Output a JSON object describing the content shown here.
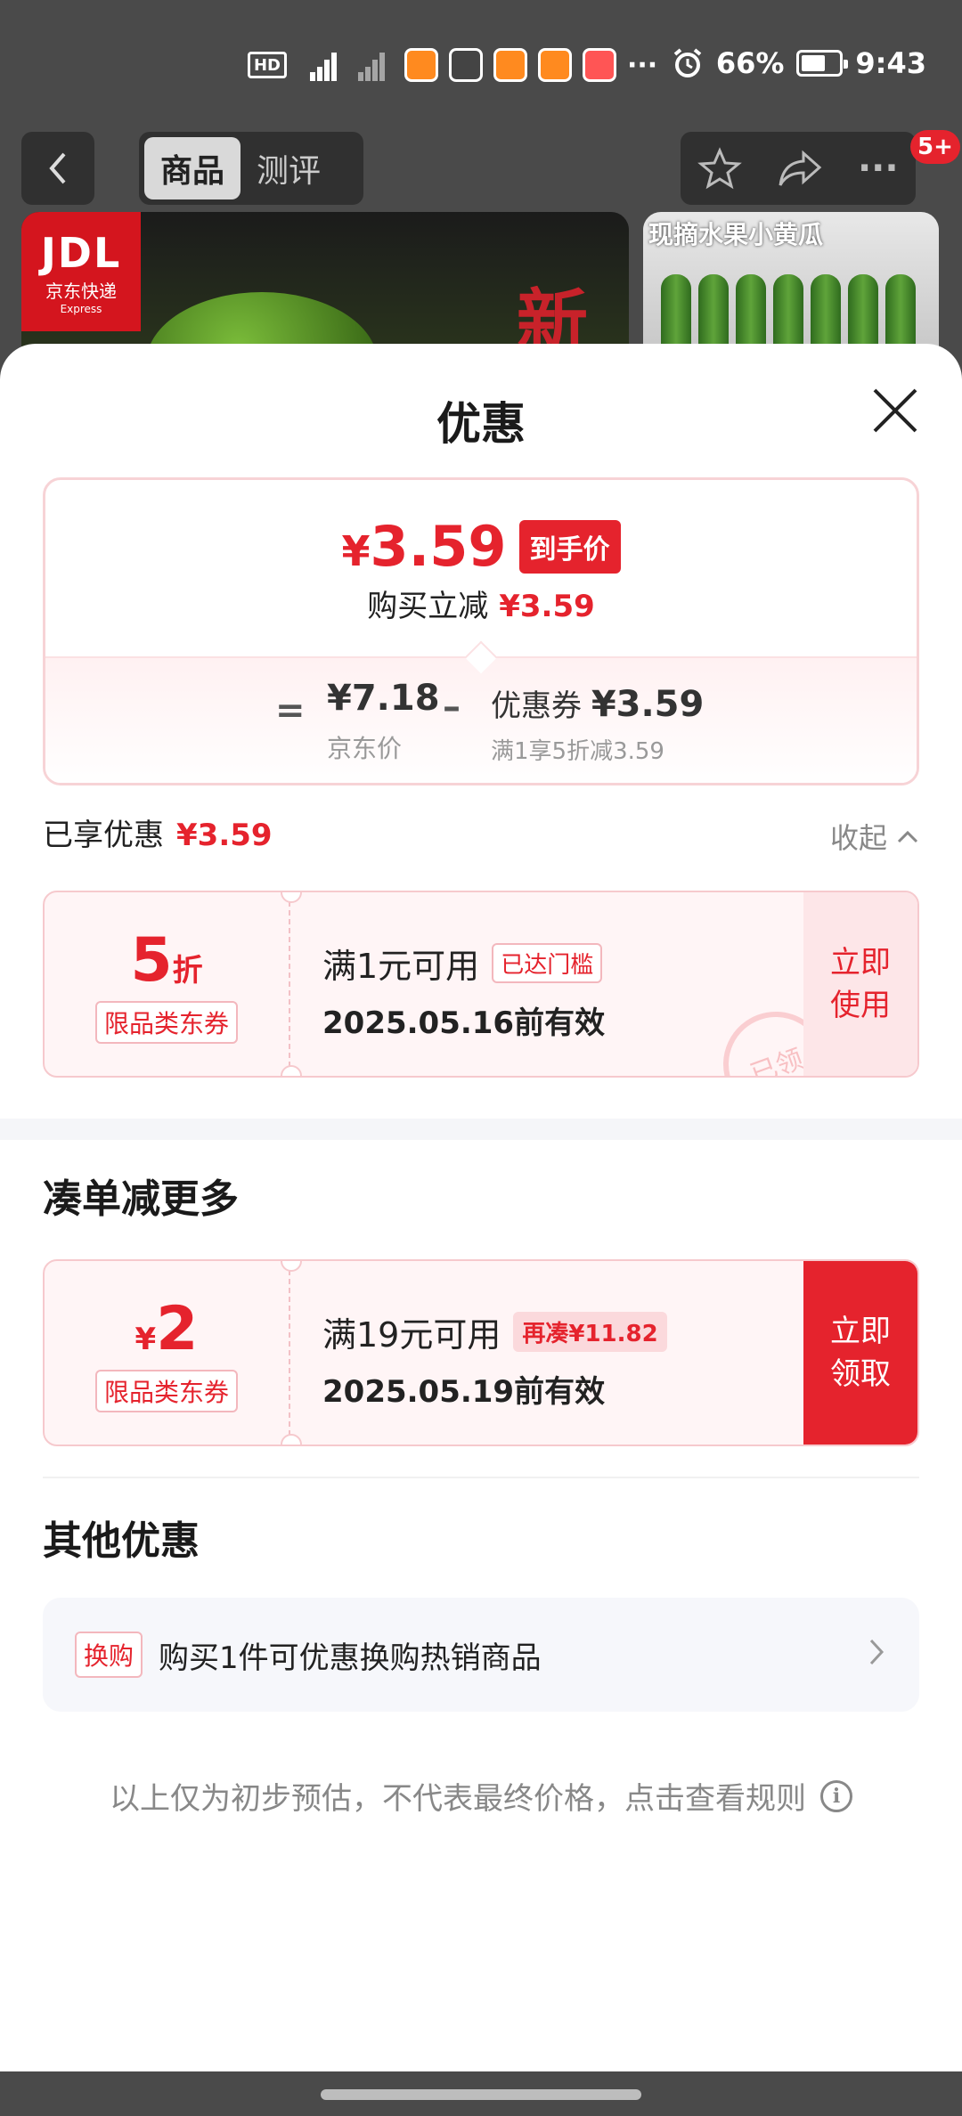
{
  "status": {
    "hd": "HD",
    "battery": "66%",
    "battery_level": 0.66,
    "time": "9:43"
  },
  "nav": {
    "tabs": [
      {
        "label": "商品"
      },
      {
        "label": "测评"
      }
    ],
    "cart_badge": "5+"
  },
  "product": {
    "img1_logo": "JDL",
    "img1_logo_cn": "京东快递",
    "img1_logo_en": "Express",
    "img1_text": "新",
    "img2_caption": "现摘水果小黄瓜"
  },
  "sheet": {
    "title": "优惠",
    "summary": {
      "final_yen": "¥",
      "final_price": "3.59",
      "final_tag": "到手价",
      "reduce_label": "购买立减",
      "reduce_value": "¥3.59",
      "eq": "=",
      "jd_price": "¥7.18",
      "jd_price_label": "京东价",
      "minus": "–",
      "coupon_label": "优惠券",
      "coupon_value": "¥3.59",
      "coupon_desc": "满1享5折减3.59"
    },
    "enjoyed": {
      "label": "已享优惠",
      "value": "¥3.59",
      "collapse": "收起"
    },
    "coupon1": {
      "value": "5",
      "unit": "折",
      "category": "限品类东券",
      "condition": "满1元可用",
      "tag": "已达门槛",
      "date": "2025.05.16前有效",
      "action": "立即\n使用",
      "stamp": "已领"
    },
    "more_title": "凑单减更多",
    "coupon2": {
      "unit": "¥",
      "value": "2",
      "category": "限品类东券",
      "condition": "满19元可用",
      "tag": "再凑¥11.82",
      "date": "2025.05.19前有效",
      "action": "立即\n领取"
    },
    "other_title": "其他优惠",
    "other": {
      "tag": "换购",
      "text": "购买1件可优惠换购热销商品"
    },
    "disclaimer": "以上仅为初步预估，不代表最终价格，点击查看规则"
  }
}
